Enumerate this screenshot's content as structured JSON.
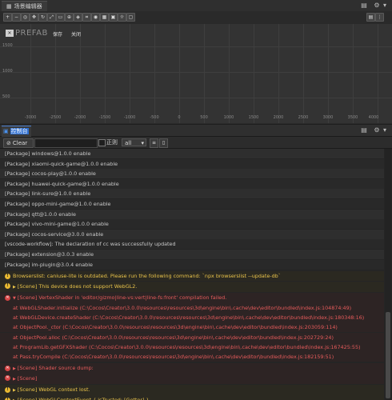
{
  "scene_editor": {
    "tab_title": "场景编辑器",
    "prefab_label": "PREFAB",
    "save_label": "保存",
    "close_label": "关闭",
    "y_ticks": [
      "1500",
      "1000",
      "500"
    ],
    "x_ticks": [
      "-3000",
      "-2500",
      "-2000",
      "-1500",
      "-1000",
      "-500",
      "0",
      "500",
      "1000",
      "1500",
      "2000",
      "2500",
      "3000",
      "3500",
      "4000"
    ]
  },
  "console": {
    "tab_title": "控制台",
    "toolbar": {
      "clear_label": "Clear",
      "filter_value": "",
      "regex_label": "正则",
      "level_value": "all"
    },
    "logs": [
      {
        "type": "info",
        "text": "[Package] windows@1.0.0 enable"
      },
      {
        "type": "info",
        "text": "[Package] xiaomi-quick-game@1.0.0 enable"
      },
      {
        "type": "info",
        "text": "[Package] cocos-play@1.0.0 enable"
      },
      {
        "type": "info",
        "text": "[Package] huawei-quick-game@1.0.0 enable"
      },
      {
        "type": "info",
        "text": "[Package] link-sure@1.0.0 enable"
      },
      {
        "type": "info",
        "text": "[Package] oppo-mini-game@1.0.0 enable"
      },
      {
        "type": "info",
        "text": "[Package] qtt@1.0.0 enable"
      },
      {
        "type": "info",
        "text": "[Package] vivo-mini-game@1.0.0 enable"
      },
      {
        "type": "info",
        "text": "[Package] cocos-service@3.0.0 enable"
      },
      {
        "type": "info",
        "text": "[vscode-workflow]: The declaration of cc was successfully updated"
      },
      {
        "type": "info",
        "text": "[Package] extension@3.0.3 enable"
      },
      {
        "type": "info",
        "text": "[Package] im-plugin@3.0.4 enable"
      },
      {
        "type": "warn",
        "text": "Browserslist: caniuse-lite is outdated. Please run the following command: `npx browserslist --update-db`"
      },
      {
        "type": "warn",
        "text": "[Scene] This device does not support WebGL2."
      },
      {
        "type": "err",
        "text": "[Scene] VertexShader in 'editor/gizmo|line-vs:vert|line-fs:front' compilation failed."
      },
      {
        "type": "stack",
        "text": "at WebGLShader.initialize (C:\\Cocos\\Creator\\3.0.0\\resources\\resources\\3d\\engine\\bin\\.cache\\dev\\editor\\bundled\\index.js:104874:49)"
      },
      {
        "type": "stack",
        "text": "at WebGLDevice.createShader (C:\\Cocos\\Creator\\3.0.0\\resources\\resources\\3d\\engine\\bin\\.cache\\dev\\editor\\bundled\\index.js:180348:16)"
      },
      {
        "type": "stack",
        "text": "at ObjectPool._ctor (C:\\Cocos\\Creator\\3.0.0\\resources\\resources\\3d\\engine\\bin\\.cache\\dev\\editor\\bundled\\index.js:203059:114)"
      },
      {
        "type": "stack",
        "text": "at ObjectPool.alloc (C:\\Cocos\\Creator\\3.0.0\\resources\\resources\\3d\\engine\\bin\\.cache\\dev\\editor\\bundled\\index.js:202729:24)"
      },
      {
        "type": "stack",
        "text": "at ProgramLib.getGFXShader (C:\\Cocos\\Creator\\3.0.0\\resources\\resources\\3d\\engine\\bin\\.cache\\dev\\editor\\bundled\\index.js:167425:55)"
      },
      {
        "type": "stack",
        "text": "at Pass.tryCompile (C:\\Cocos\\Creator\\3.0.0\\resources\\resources\\3d\\engine\\bin\\.cache\\dev\\editor\\bundled\\index.js:182159:51)"
      },
      {
        "type": "err",
        "text": "[Scene] Shader source dump:"
      },
      {
        "type": "err",
        "text": "[Scene]"
      },
      {
        "type": "warn",
        "text": "[Scene] WebGL context lost."
      },
      {
        "type": "warn",
        "text": "[Scene] WebGLContextEvent { isTrusted: [Getter] }"
      }
    ]
  },
  "colors": {
    "accent": "#2f6fd0",
    "warning": "#e8c24a",
    "error": "#e65b5b"
  }
}
